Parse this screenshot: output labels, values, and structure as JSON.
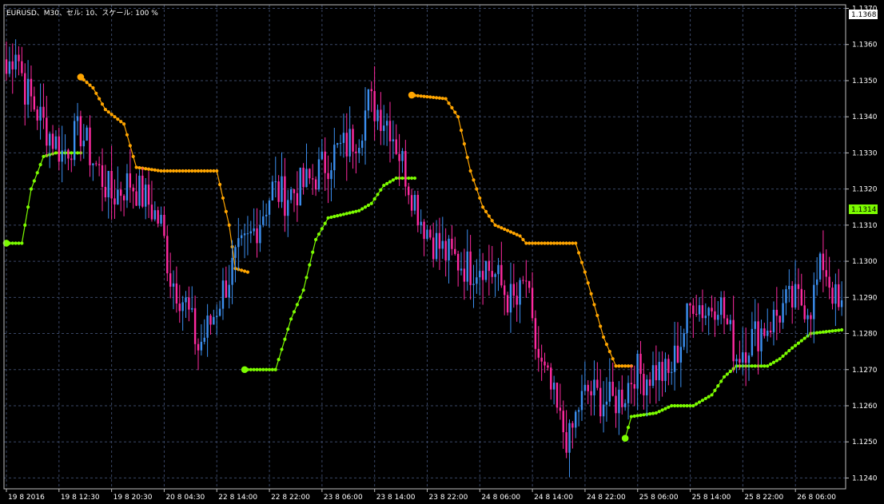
{
  "chart_title": "EURUSD、M30、セル: 10、スケール: 100 %",
  "colors": {
    "background": "#000000",
    "grid": "#3a4766",
    "axis": "#c0c0c0",
    "text": "#ffffff",
    "candle_up": "#3b8ff0",
    "candle_down": "#ff2aa0",
    "trail_bear": "#ffa500",
    "trail_bull": "#7cfc00",
    "current_badge_bg": "#ffffff",
    "current_badge_text": "#000000",
    "indicator_badge_bg": "#7cfc00",
    "indicator_badge_text": "#000000"
  },
  "price_labels": {
    "current": "1.1368",
    "indicator": "1.1314"
  },
  "chart_data": {
    "type": "candlestick",
    "symbol": "EURUSD",
    "timeframe": "M30",
    "grid": true,
    "ylim": [
      1.1237,
      1.1371
    ],
    "y_ticks": [
      "1.1370",
      "1.1360",
      "1.1350",
      "1.1340",
      "1.1330",
      "1.1320",
      "1.1310",
      "1.1300",
      "1.1290",
      "1.1280",
      "1.1270",
      "1.1260",
      "1.1250",
      "1.1240"
    ],
    "x_ticks": [
      "19 8 2016",
      "19 8 12:30",
      "19 8 20:30",
      "20 8 04:30",
      "22 8 14:00",
      "22 8 22:00",
      "23 8 06:00",
      "23 8 14:00",
      "23 8 22:00",
      "24 8 06:00",
      "24 8 14:00",
      "24 8 22:00",
      "25 8 06:00",
      "25 8 14:00",
      "25 8 22:00",
      "26 8 06:00"
    ],
    "anchors": [
      [
        0,
        1.1352
      ],
      [
        3,
        1.136
      ],
      [
        6,
        1.1348
      ],
      [
        12,
        1.1338
      ],
      [
        18,
        1.133
      ],
      [
        24,
        1.1336
      ],
      [
        28,
        1.1328
      ],
      [
        34,
        1.1318
      ],
      [
        40,
        1.1322
      ],
      [
        46,
        1.1316
      ],
      [
        50,
        1.131
      ],
      [
        53,
        1.1296
      ],
      [
        58,
        1.1288
      ],
      [
        62,
        1.1276
      ],
      [
        66,
        1.1283
      ],
      [
        70,
        1.1292
      ],
      [
        74,
        1.13
      ],
      [
        78,
        1.1305
      ],
      [
        82,
        1.1312
      ],
      [
        86,
        1.132
      ],
      [
        90,
        1.1318
      ],
      [
        94,
        1.132
      ],
      [
        98,
        1.1322
      ],
      [
        102,
        1.1326
      ],
      [
        106,
        1.133
      ],
      [
        110,
        1.1332
      ],
      [
        114,
        1.1336
      ],
      [
        117,
        1.1344
      ],
      [
        120,
        1.1342
      ],
      [
        124,
        1.1338
      ],
      [
        127,
        1.133
      ],
      [
        130,
        1.1322
      ],
      [
        134,
        1.1312
      ],
      [
        138,
        1.1306
      ],
      [
        142,
        1.1302
      ],
      [
        146,
        1.13
      ],
      [
        150,
        1.1298
      ],
      [
        154,
        1.13
      ],
      [
        158,
        1.1296
      ],
      [
        162,
        1.129
      ],
      [
        165,
        1.1288
      ],
      [
        168,
        1.1295
      ],
      [
        170,
        1.128
      ],
      [
        173,
        1.127
      ],
      [
        176,
        1.1264
      ],
      [
        179,
        1.1255
      ],
      [
        182,
        1.125
      ],
      [
        185,
        1.126
      ],
      [
        188,
        1.1264
      ],
      [
        192,
        1.1262
      ],
      [
        196,
        1.1261
      ],
      [
        200,
        1.1264
      ],
      [
        203,
        1.127
      ],
      [
        206,
        1.1268
      ],
      [
        210,
        1.127
      ],
      [
        214,
        1.1268
      ],
      [
        218,
        1.1278
      ],
      [
        222,
        1.129
      ],
      [
        226,
        1.1286
      ],
      [
        230,
        1.129
      ],
      [
        233,
        1.1282
      ],
      [
        236,
        1.1274
      ],
      [
        240,
        1.1278
      ],
      [
        244,
        1.1281
      ],
      [
        248,
        1.1284
      ],
      [
        252,
        1.1288
      ],
      [
        256,
        1.1289
      ],
      [
        260,
        1.1288
      ],
      [
        264,
        1.13
      ],
      [
        267,
        1.1292
      ],
      [
        269,
        1.1286
      ]
    ],
    "trail_bear_segments": [
      [
        [
          24,
          1.1351
        ],
        [
          28,
          1.1348
        ],
        [
          32,
          1.1342
        ],
        [
          38,
          1.1338
        ],
        [
          42,
          1.1326
        ],
        [
          50,
          1.1325
        ],
        [
          68,
          1.1325
        ],
        [
          72,
          1.131
        ],
        [
          74,
          1.1298
        ],
        [
          78,
          1.1297
        ]
      ],
      [
        [
          131,
          1.1346
        ],
        [
          142,
          1.1345
        ],
        [
          146,
          1.134
        ],
        [
          150,
          1.1325
        ],
        [
          154,
          1.1315
        ],
        [
          158,
          1.131
        ],
        [
          166,
          1.1307
        ],
        [
          168,
          1.1305
        ],
        [
          184,
          1.1305
        ],
        [
          187,
          1.1297
        ],
        [
          193,
          1.1279
        ],
        [
          197,
          1.1271
        ],
        [
          202,
          1.1271
        ]
      ]
    ],
    "trail_bull_segments": [
      [
        [
          0,
          1.1305
        ],
        [
          5,
          1.1305
        ],
        [
          8,
          1.132
        ],
        [
          12,
          1.1329
        ],
        [
          16,
          1.133
        ],
        [
          24,
          1.133
        ]
      ],
      [
        [
          77,
          1.127
        ],
        [
          87,
          1.127
        ],
        [
          92,
          1.1284
        ],
        [
          96,
          1.1292
        ],
        [
          100,
          1.1306
        ],
        [
          104,
          1.1312
        ],
        [
          114,
          1.1314
        ],
        [
          118,
          1.1316
        ],
        [
          122,
          1.1321
        ],
        [
          126,
          1.1323
        ],
        [
          132,
          1.1323
        ]
      ],
      [
        [
          200,
          1.1251
        ],
        [
          202,
          1.1257
        ],
        [
          210,
          1.1258
        ],
        [
          215,
          1.126
        ],
        [
          222,
          1.126
        ],
        [
          228,
          1.1263
        ],
        [
          232,
          1.1268
        ],
        [
          236,
          1.1271
        ],
        [
          246,
          1.1271
        ],
        [
          250,
          1.1273
        ],
        [
          254,
          1.1276
        ],
        [
          260,
          1.128
        ],
        [
          270,
          1.1281
        ]
      ]
    ]
  }
}
